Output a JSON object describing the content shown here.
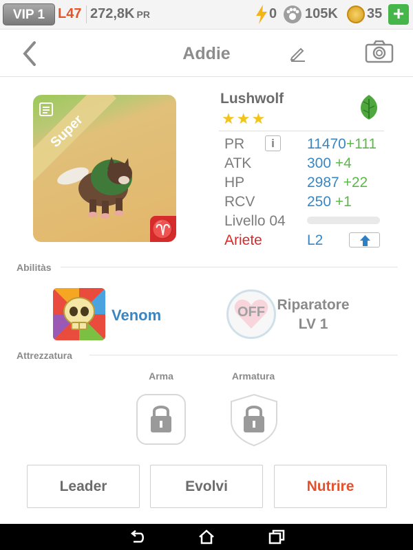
{
  "status": {
    "vip": "VIP 1",
    "level": "L47",
    "power": "272,8K",
    "power_unit": "PR",
    "energy": "0",
    "paw": "105K",
    "coins": "35",
    "plus": "+"
  },
  "header": {
    "title": "Addie"
  },
  "portrait": {
    "rarity": "Super",
    "zodiac_symbol": "♈"
  },
  "pet": {
    "species": "Lushwolf",
    "stars": "★★★",
    "stats": [
      {
        "label": "PR",
        "value": "11470",
        "bonus": "+111"
      },
      {
        "label": "ATK",
        "value": "300",
        "bonus": "+4"
      },
      {
        "label": "HP",
        "value": "2987",
        "bonus": "+22"
      },
      {
        "label": "RCV",
        "value": "250",
        "bonus": "+1"
      }
    ],
    "info_btn": "i",
    "level_label": "Livello 04",
    "level_progress": 0,
    "zodiac": "Ariete",
    "zodiac_level": "L2"
  },
  "abilities": {
    "label": "Abilitàs",
    "ability_name": "Venom",
    "off_label": "OFF",
    "skill_name": "Riparatore",
    "skill_level": "LV 1"
  },
  "equipment": {
    "label": "Attrezzatura",
    "weapon": "Arma",
    "armor": "Armatura"
  },
  "buttons": {
    "leader": "Leader",
    "evolve": "Evolvi",
    "feed": "Nutrire"
  },
  "colors": {
    "accent_blue": "#3a86c2",
    "bonus_green": "#5cb84a",
    "accent_orange": "#e5512b",
    "zodiac_red": "#d62b2b"
  }
}
